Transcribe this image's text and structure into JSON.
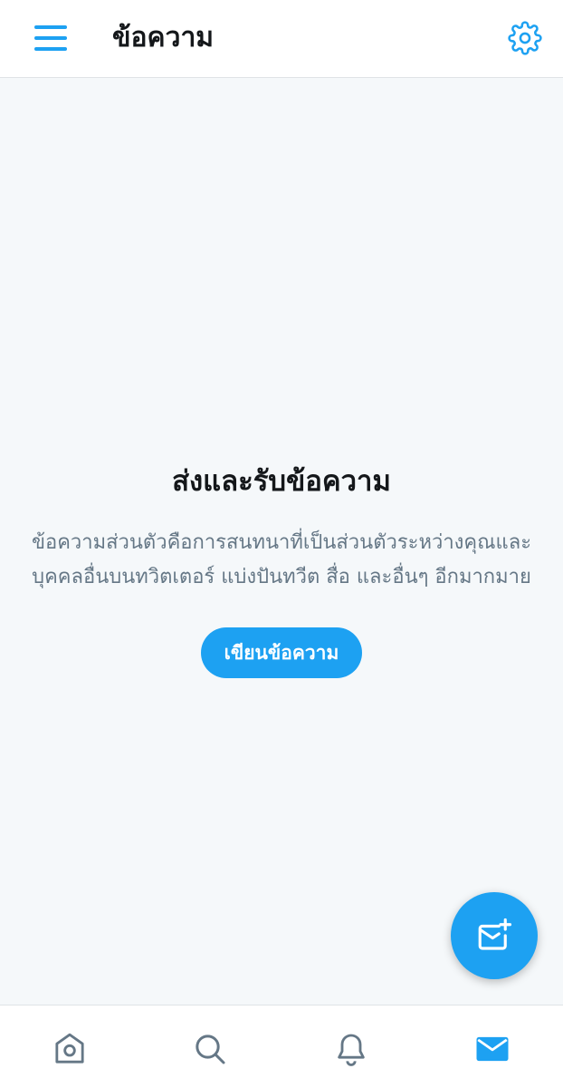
{
  "header": {
    "title": "ข้อความ",
    "menu_icon": "hamburger-menu-icon",
    "settings_icon": "gear-icon"
  },
  "empty_state": {
    "title": "ส่งและรับข้อความ",
    "description": "ข้อความส่วนตัวคือการสนทนาที่เป็นส่วนตัวระหว่างคุณและบุคคลอื่นบนทวิตเตอร์ แบ่งปันทวีต สื่อ และอื่นๆ อีกมากมาย",
    "button_label": "เขียนข้อความ"
  },
  "fab": {
    "icon": "new-message-icon"
  },
  "bottom_nav": {
    "items": [
      {
        "name": "home",
        "icon": "home-icon",
        "active": false
      },
      {
        "name": "search",
        "icon": "search-icon",
        "active": false
      },
      {
        "name": "notifications",
        "icon": "bell-icon",
        "active": false
      },
      {
        "name": "messages",
        "icon": "envelope-icon",
        "active": true
      }
    ]
  },
  "colors": {
    "accent": "#1da1f2",
    "text_primary": "#14171a",
    "text_secondary": "#657786",
    "background": "#f5f8fa",
    "icon_inactive": "#657786"
  }
}
